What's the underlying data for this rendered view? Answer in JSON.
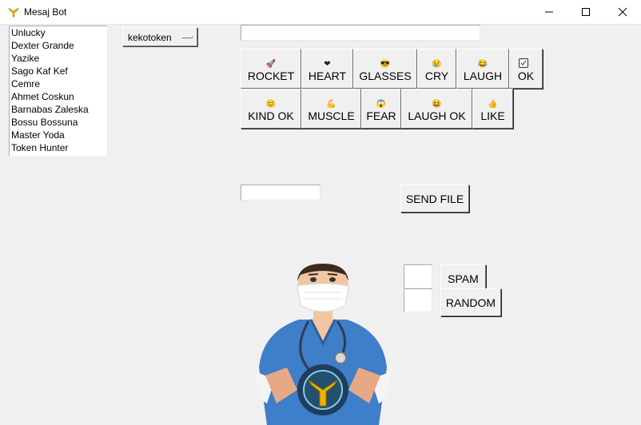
{
  "window": {
    "title": "Mesaj Bot",
    "icon": "app-logo-icon"
  },
  "window_controls": {
    "minimize": "minimize-icon",
    "maximize": "maximize-icon",
    "close": "close-icon"
  },
  "user_list": [
    "Unlucky",
    "Dexter Grande",
    "Yazike",
    "Sago Kaf Kef",
    "Cemre",
    "Ahmet Coskun",
    "Barnabas Zaleska",
    "Bossu Bossuna",
    "Master Yoda",
    "Token Hunter"
  ],
  "token_select": {
    "value": "kekotoken"
  },
  "message_input": {
    "value": ""
  },
  "emoji_buttons": {
    "rocket": {
      "label": "ROCKET",
      "glyph": "🚀"
    },
    "heart": {
      "label": "HEART",
      "glyph": "❤"
    },
    "glasses": {
      "label": "GLASSES",
      "glyph": "😎"
    },
    "cry": {
      "label": "CRY",
      "glyph": "😢"
    },
    "laugh": {
      "label": "LAUGH",
      "glyph": "😂"
    },
    "ok": {
      "label": "OK",
      "icon": "checkbox-icon"
    },
    "kind_ok": {
      "label": "KIND OK",
      "glyph": "😊"
    },
    "muscle": {
      "label": "MUSCLE",
      "glyph": "💪"
    },
    "fear": {
      "label": "FEAR",
      "glyph": "😱"
    },
    "laugh_ok": {
      "label": "LAUGH OK",
      "glyph": "😆"
    },
    "like": {
      "label": "LIKE",
      "glyph": "👍"
    }
  },
  "file_input": {
    "value": ""
  },
  "send_file_button": {
    "label": "SEND FILE"
  },
  "spam_count_input": {
    "value": ""
  },
  "spam_button": {
    "label": "SPAM"
  },
  "random_count_input": {
    "value": ""
  },
  "random_button": {
    "label": "RANDOM"
  },
  "illustration": {
    "name": "doctor-illustration"
  }
}
